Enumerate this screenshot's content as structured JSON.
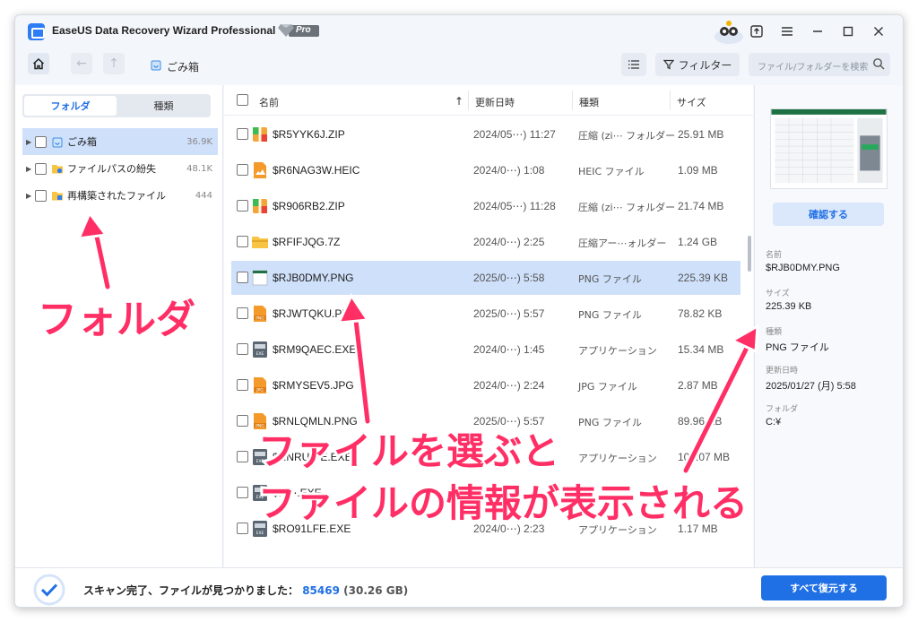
{
  "window": {
    "title": "EaseUS Data Recovery Wizard Professional",
    "badge": "Pro"
  },
  "toolbar": {
    "breadcrumb": "ごみ箱",
    "filter_label": "フィルター",
    "search_placeholder": "ファイル/フォルダーを検索"
  },
  "sidebar": {
    "tabs": [
      "フォルダ",
      "種類"
    ],
    "active_tab": "フォルダ",
    "items": [
      {
        "label": "ごみ箱",
        "count": "36.9K",
        "icon": "recycle-bin-icon"
      },
      {
        "label": "ファイルパスの紛失",
        "count": "48.1K",
        "icon": "lost-path-folder-icon"
      },
      {
        "label": "再構築されたファイル",
        "count": "444",
        "icon": "rebuilt-folder-icon"
      }
    ]
  },
  "table": {
    "columns": [
      "名前",
      "更新日時",
      "種類",
      "サイズ"
    ],
    "rows": [
      {
        "name": "$R5YYK6J.ZIP",
        "date": "2024/05⋯) 11:27",
        "type": "圧縮 (zi⋯ フォルダー",
        "size": "25.91 MB",
        "icon": "zip-icon"
      },
      {
        "name": "$R6NAG3W.HEIC",
        "date": "2024/0⋯) 1:08",
        "type": "HEIC ファイル",
        "size": "1.09 MB",
        "icon": "image-icon"
      },
      {
        "name": "$R906RB2.ZIP",
        "date": "2024/05⋯) 11:28",
        "type": "圧縮 (zi⋯ フォルダー",
        "size": "21.74 MB",
        "icon": "zip-icon"
      },
      {
        "name": "$RFIFJQG.7Z",
        "date": "2024/0⋯) 2:25",
        "type": "圧縮アー⋯ォルダー",
        "size": "1.24 GB",
        "icon": "archive-folder-icon"
      },
      {
        "name": "$RJB0DMY.PNG",
        "date": "2025/0⋯) 5:58",
        "type": "PNG ファイル",
        "size": "225.39 KB",
        "icon": "png-thumb-icon"
      },
      {
        "name": "$RJWTQKU.PNG",
        "date": "2025/0⋯) 5:57",
        "type": "PNG ファイル",
        "size": "78.82 KB",
        "icon": "png-icon"
      },
      {
        "name": "$RM9QAEC.EXE",
        "date": "2024/0⋯) 1:45",
        "type": "アプリケーション",
        "size": "15.34 MB",
        "icon": "exe-icon"
      },
      {
        "name": "$RMYSEV5.JPG",
        "date": "2024/0⋯) 2:24",
        "type": "JPG ファイル",
        "size": "2.87 MB",
        "icon": "jpg-icon"
      },
      {
        "name": "$RNLQMLN.PNG",
        "date": "2025/0⋯) 5:57",
        "type": "PNG ファイル",
        "size": "89.96 KB",
        "icon": "png-icon"
      },
      {
        "name": "$RNRU⋯E.EXE",
        "date": "",
        "type": "アプリケーション",
        "size": "107.07 MB",
        "icon": "exe-icon"
      },
      {
        "name": "$R⋯.EXE",
        "date": "",
        "type": "",
        "size": "",
        "icon": "exe-icon"
      },
      {
        "name": "$RO91LFE.EXE",
        "date": "2024/0⋯) 2:23",
        "type": "アプリケーション",
        "size": "1.17 MB",
        "icon": "exe-icon"
      }
    ],
    "selected_row": 4
  },
  "details": {
    "confirm_label": "確認する",
    "fields": [
      {
        "label": "名前",
        "value": "$RJB0DMY.PNG"
      },
      {
        "label": "サイズ",
        "value": "225.39 KB"
      },
      {
        "label": "種類",
        "value": "PNG ファイル"
      },
      {
        "label": "更新日時",
        "value": "2025/01/27 (月) 5:58"
      },
      {
        "label": "フォルダ",
        "value": "C:¥"
      }
    ]
  },
  "status": {
    "message": "スキャン完了、ファイルが見つかりました：",
    "count": "85469",
    "size": "(30.26 GB)",
    "recover_all_label": "すべて復元する"
  },
  "annotations": {
    "left": "フォルダ",
    "line1": "ファイルを選ぶと",
    "line2": "ファイルの情報が表示される",
    "color": "#ff2f66"
  }
}
